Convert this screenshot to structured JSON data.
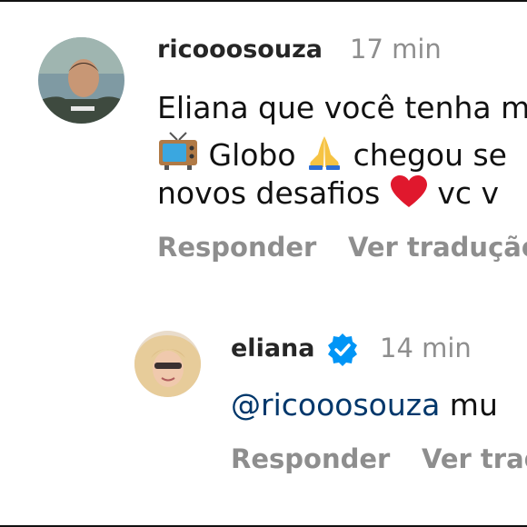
{
  "comments": [
    {
      "username": "ricooosouza",
      "time": "17 min",
      "line1": "Eliana que você tenha m",
      "line2_word1": "Globo",
      "line2_rest": "chegou se",
      "line3_start": "novos desafios",
      "line3_end": "vc v",
      "reply_label": "Responder",
      "translate_label": "Ver tradução",
      "icons": [
        "tv-emoji",
        "folded-hands-emoji",
        "red-heart-emoji"
      ]
    },
    {
      "username": "eliana",
      "verified": true,
      "time": "14 min",
      "mention": "@ricooosouza",
      "text_after_mention": "mu",
      "reply_label": "Responder",
      "translate_label": "Ver trad"
    }
  ],
  "colors": {
    "secondary_text": "#8e8e8e",
    "mention": "#00376b",
    "verified_badge": "#0095f6"
  }
}
